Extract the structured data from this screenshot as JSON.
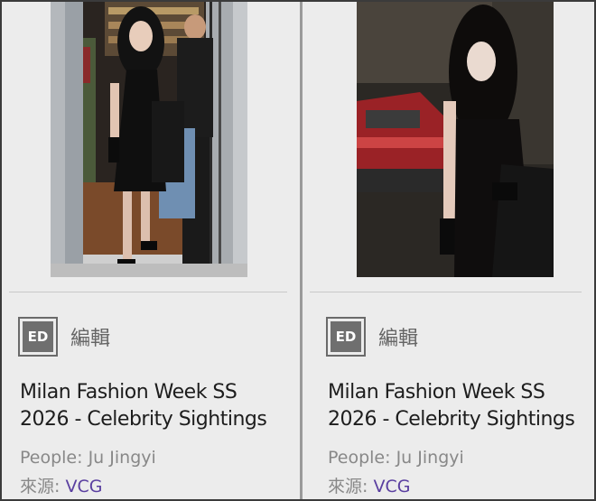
{
  "cards": [
    {
      "editor_badge": "ED",
      "editor_label": "編輯",
      "title": "Milan Fashion Week SS 2026 - Celebrity Sightings",
      "people_label": "People: ",
      "people_value": "Ju Jingyi",
      "source_label": "來源: ",
      "source_value": "VCG"
    },
    {
      "editor_badge": "ED",
      "editor_label": "編輯",
      "title": "Milan Fashion Week SS 2026 - Celebrity Sightings",
      "people_label": "People: ",
      "people_value": "Ju Jingyi",
      "source_label": "來源: ",
      "source_value": "VCG"
    }
  ],
  "colors": {
    "card_bg": "#ececec",
    "link": "#5a3fa0",
    "badge_bg": "#6f6f6f"
  }
}
